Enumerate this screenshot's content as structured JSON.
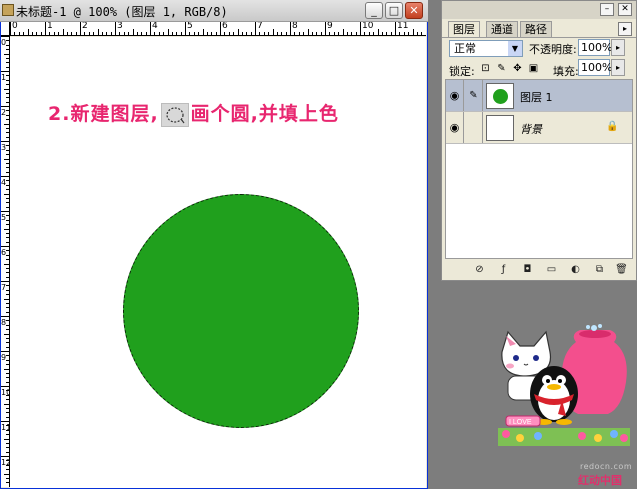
{
  "document": {
    "title": "未标题-1 @ 100% (图层 1, RGB/8)",
    "minimize_glyph": "_",
    "maximize_glyph": "□",
    "close_glyph": "✕",
    "ruler_h_labels": [
      "0",
      "1",
      "2",
      "3",
      "4",
      "5",
      "6",
      "7",
      "8",
      "9",
      "10",
      "11"
    ],
    "ruler_v_labels": [
      "0",
      "1",
      "2",
      "3",
      "4",
      "5",
      "6",
      "7",
      "8",
      "9",
      "10",
      "11",
      "12"
    ]
  },
  "canvas": {
    "instruction_prefix": "2.新建图层,",
    "instruction_suffix": "画个圆,并填上色",
    "circle_color": "#20a01d",
    "instruction_color": "#e8266f",
    "tool_icon": "elliptical-marquee-icon"
  },
  "layers_panel": {
    "tabs": [
      {
        "label": "图层"
      },
      {
        "label": "通道"
      },
      {
        "label": "路径"
      }
    ],
    "menu_glyph": "▸",
    "blend_mode": "正常",
    "opacity_label": "不透明度:",
    "opacity_value": "100%",
    "lock_label": "锁定:",
    "fill_label": "填充:",
    "fill_value": "100%",
    "layers": [
      {
        "name": "图层 1",
        "visible": true,
        "selected": true
      },
      {
        "name": "背景",
        "visible": true,
        "locked": true
      }
    ],
    "eye_glyph": "👁",
    "brush_glyph": "✎",
    "lock_glyph": "🔒",
    "bottom_icons": [
      "link-icon",
      "layer-style-icon",
      "mask-icon",
      "group-icon",
      "adjustment-icon",
      "new-layer-icon",
      "trash-icon"
    ]
  },
  "watermark": {
    "site": "redocn.com",
    "cn": "红动中国"
  }
}
